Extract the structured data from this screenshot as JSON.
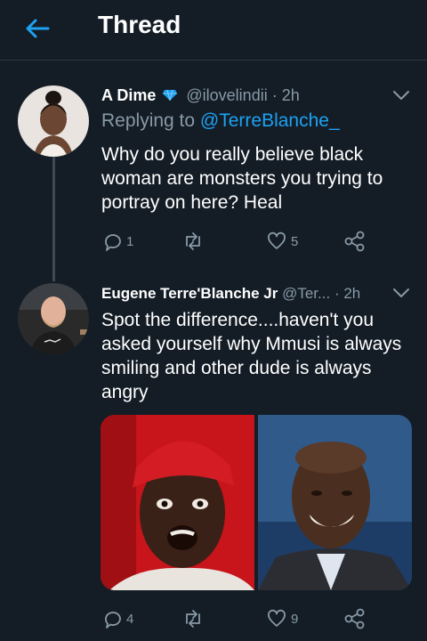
{
  "header": {
    "title": "Thread"
  },
  "tweets": [
    {
      "name": "A Dime",
      "handle": "@ilovelindii",
      "time": "· 2h",
      "replying_prefix": "Replying to",
      "replying_to": "@TerreBlanche_",
      "text": "Why do you really believe black woman are monsters you trying to portray on here? Heal",
      "replies": "1",
      "retweets": "",
      "likes": "5"
    },
    {
      "name": "Eugene Terre'Blanche Jr",
      "handle": "@Ter...",
      "time": "· 2h",
      "text": "Spot the difference....haven't you asked yourself why Mmusi is always smiling and other dude is always angry",
      "replies": "4",
      "retweets": "",
      "likes": "9"
    }
  ],
  "colors": {
    "background": "#141d26",
    "accent": "#1da1f2",
    "muted": "#8899a6",
    "verified": "#1da1f2"
  },
  "icons": {
    "back": "arrow-left-icon",
    "verified": "diamond-icon",
    "caret": "chevron-down-icon",
    "reply": "reply-icon",
    "retweet": "retweet-icon",
    "like": "heart-icon",
    "share": "share-icon"
  }
}
